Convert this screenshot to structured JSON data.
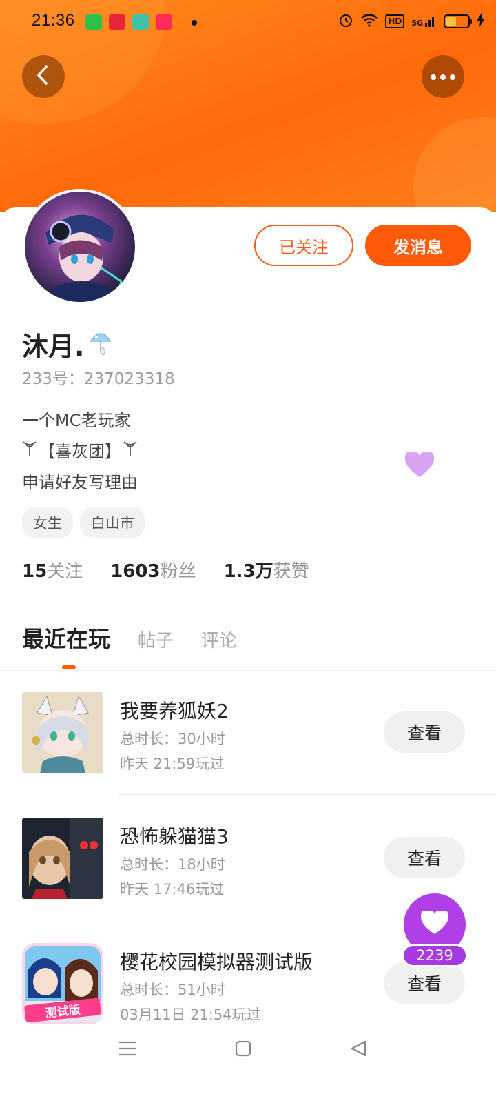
{
  "status_bar": {
    "time": "21:36",
    "network": "5G",
    "hd": "HD"
  },
  "header": {
    "back_label": "返回",
    "more_label": "更多"
  },
  "profile": {
    "name": "沐月.",
    "uid": "233号：237023318",
    "bio": [
      "一个MC老玩家",
      "【喜灰团】",
      "申请好友写理由"
    ],
    "tags": [
      "女生",
      "白山市"
    ],
    "follow_button": "已关注",
    "message_button": "发消息",
    "stats": [
      {
        "value": "15",
        "label": "关注"
      },
      {
        "value": "1603",
        "label": "粉丝"
      },
      {
        "value": "1.3万",
        "label": "获赞"
      }
    ]
  },
  "tabs": [
    "最近在玩",
    "帖子",
    "评论"
  ],
  "games": [
    {
      "title": "我要养狐妖2",
      "duration": "总时长：30小时",
      "last_played": "昨天 21:59玩过",
      "button": "查看"
    },
    {
      "title": "恐怖躲猫猫3",
      "duration": "总时长：18小时",
      "last_played": "昨天 17:46玩过",
      "button": "查看"
    },
    {
      "title": "樱花校园模拟器测试版",
      "duration": "总时长：51小时",
      "last_played": "03月11日 21:54玩过",
      "button": "查看",
      "badge": "测试版"
    }
  ],
  "like_fab": {
    "count": "2239"
  },
  "colors": {
    "accent": "#ff5a0a",
    "banner": "#ff7a14",
    "fab": "#b040e6"
  }
}
